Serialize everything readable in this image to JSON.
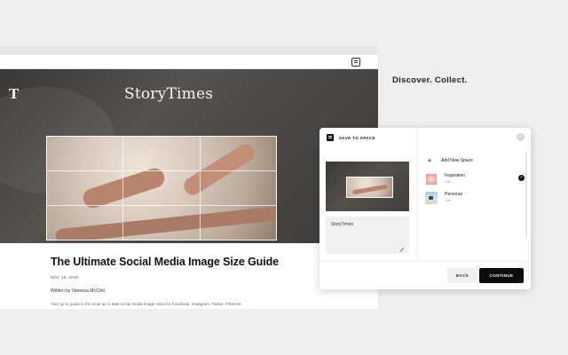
{
  "browser": {
    "hero": {
      "logo_mark": "T",
      "brand": "StoryTimes"
    },
    "article": {
      "title": "The Ultimate Social Media Image Size Guide",
      "date": "MAY 16, 2020",
      "author": "Written by Vanessa McClint",
      "body": "Your go-to guide to the most up to date social media image sizes for Facebook, Instagram, Twitter, Pinterest,"
    }
  },
  "tagline": "Discover. Collect.",
  "dialog": {
    "title": "SAVE TO SPACE",
    "close_glyph": "×",
    "note_text": "StoryTimes",
    "add_space_label": "Add New Space",
    "spaces": [
      {
        "name": "Inspiration",
        "sub": "Grid",
        "selected": true
      },
      {
        "name": "Personal",
        "sub": "Grid",
        "selected": false
      }
    ],
    "check_glyph": "✓",
    "back_label": "BACK",
    "continue_label": "CONTINUE"
  },
  "colors": {
    "background": "#efefee",
    "primary_button": "#0c0c0c",
    "secondary_button": "#f0f0f0"
  }
}
